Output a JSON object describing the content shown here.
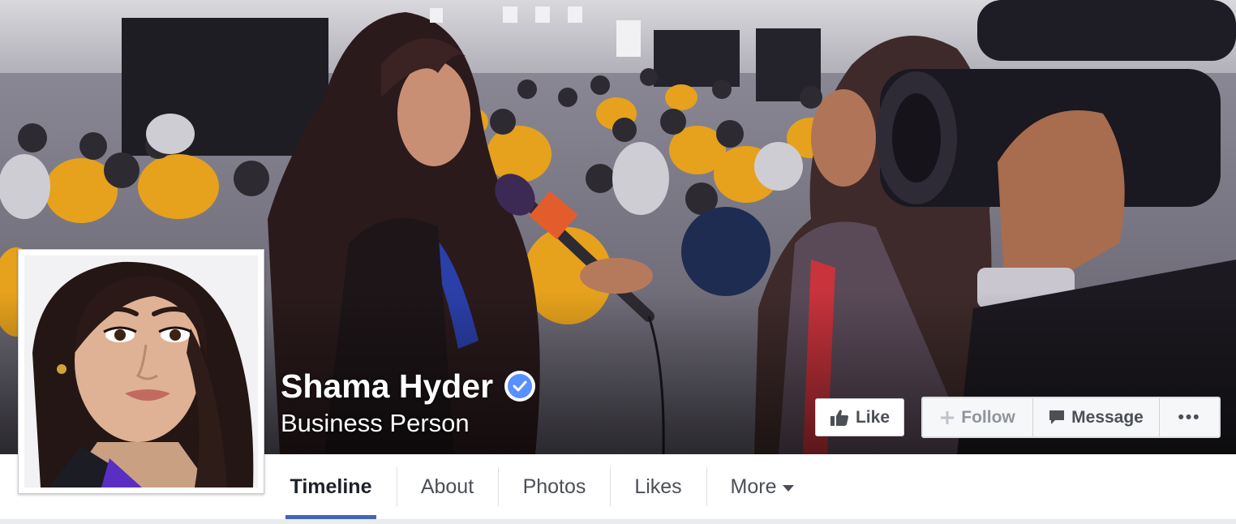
{
  "profile": {
    "name": "Shama Hyder",
    "category": "Business Person",
    "verified": true
  },
  "actions": {
    "like_label": "Like",
    "follow_label": "Follow",
    "message_label": "Message",
    "more_label": "•••"
  },
  "nav": {
    "tabs": [
      {
        "label": "Timeline",
        "active": true
      },
      {
        "label": "About",
        "active": false
      },
      {
        "label": "Photos",
        "active": false
      },
      {
        "label": "Likes",
        "active": false
      },
      {
        "label": "More",
        "active": false
      }
    ]
  },
  "colors": {
    "accent": "#4267b2",
    "verified": "#5890ff",
    "button_text": "#4b4f56",
    "disabled_text": "#90949c"
  },
  "icons": {
    "like": "thumbs-up-icon",
    "follow": "plus-icon",
    "message": "speech-bubble-icon",
    "verified": "checkmark-badge-icon",
    "more_dropdown": "caret-down-icon"
  }
}
